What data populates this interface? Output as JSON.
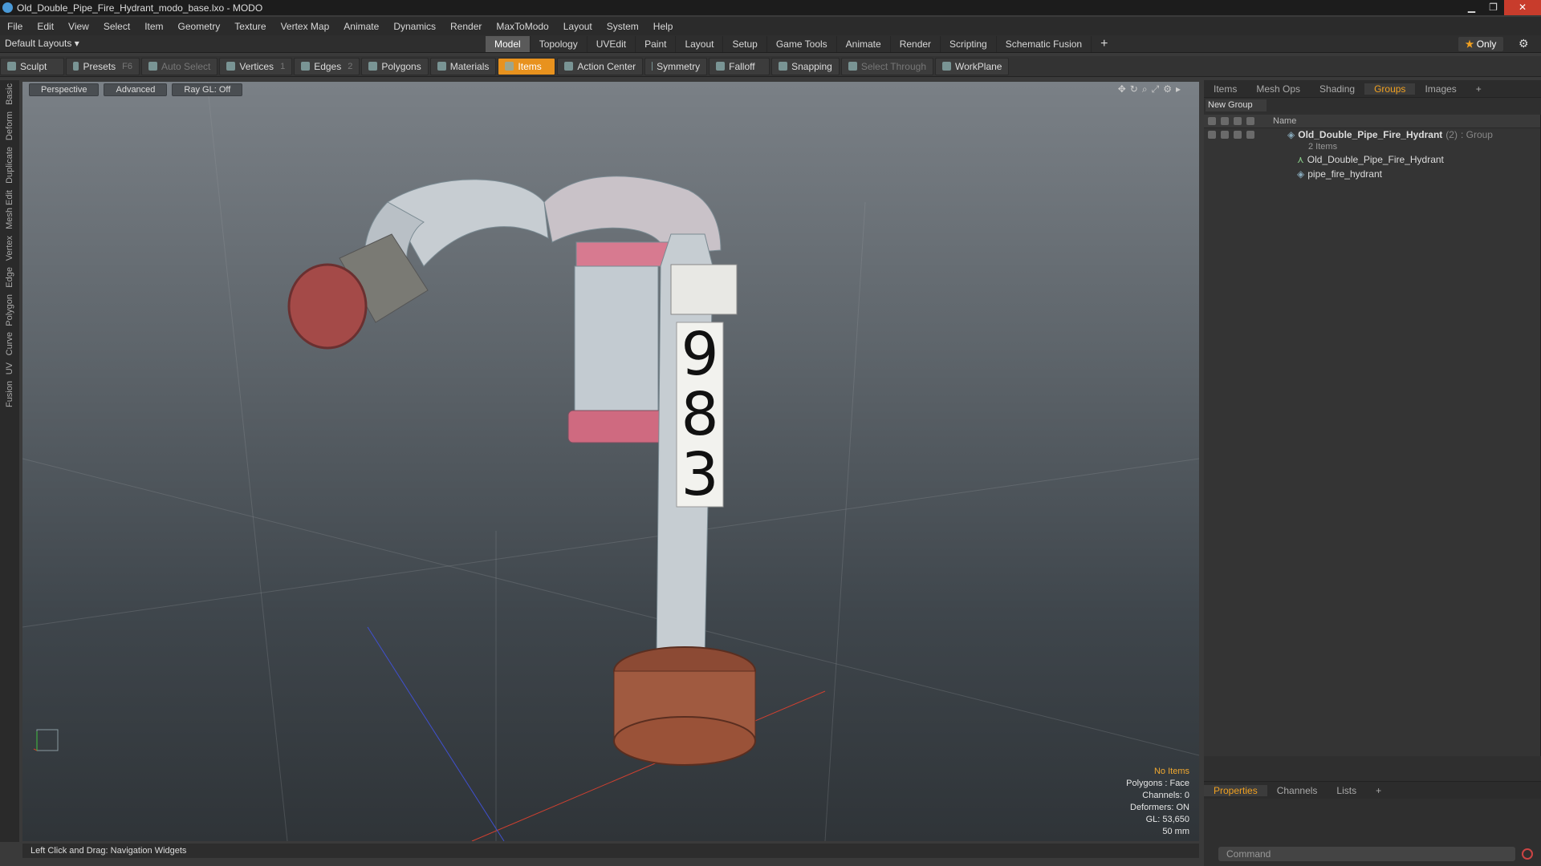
{
  "window": {
    "title": "Old_Double_Pipe_Fire_Hydrant_modo_base.lxo - MODO"
  },
  "menu": [
    "File",
    "Edit",
    "View",
    "Select",
    "Item",
    "Geometry",
    "Texture",
    "Vertex Map",
    "Animate",
    "Dynamics",
    "Render",
    "MaxToModo",
    "Layout",
    "System",
    "Help"
  ],
  "layout": {
    "default_layouts": "Default Layouts ▾",
    "tabs": [
      "Model",
      "Topology",
      "UVEdit",
      "Paint",
      "Layout",
      "Setup",
      "Game Tools",
      "Animate",
      "Render",
      "Scripting",
      "Schematic Fusion"
    ],
    "active_tab": "Model",
    "plus": "+",
    "only": "Only",
    "star": "★"
  },
  "toolbar": {
    "sculpt": "Sculpt",
    "presets": "Presets",
    "presets_key": "F6",
    "auto_select": "Auto Select",
    "vertices": "Vertices",
    "vertices_key": "1",
    "edges": "Edges",
    "edges_key": "2",
    "polygons": "Polygons",
    "materials": "Materials",
    "items": "Items",
    "action_center": "Action Center",
    "symmetry": "Symmetry",
    "falloff": "Falloff",
    "snapping": "Snapping",
    "select_through": "Select Through",
    "workplane": "WorkPlane"
  },
  "left_tabs": [
    "Basic",
    "Deform",
    "Duplicate",
    "Mesh Edit",
    "Vertex",
    "Edge",
    "Polygon",
    "Curve",
    "UV",
    "Fusion"
  ],
  "viewport": {
    "view": "Perspective",
    "advanced": "Advanced",
    "raygl": "Ray GL: Off",
    "sign_digits": [
      "9",
      "8",
      "3"
    ],
    "stats": {
      "no_items": "No Items",
      "polygons": "Polygons : Face",
      "channels": "Channels: 0",
      "deformers": "Deformers: ON",
      "gl": "GL: 53,650",
      "size": "50 mm"
    }
  },
  "status": {
    "hint": "Left Click and Drag:  Navigation Widgets"
  },
  "right_panel": {
    "tabs": [
      "Items",
      "Mesh Ops",
      "Shading",
      "Groups",
      "Images",
      "+"
    ],
    "active": "Groups",
    "new_group": "New Group",
    "name_header": "Name",
    "group": {
      "name": "Old_Double_Pipe_Fire_Hydrant",
      "count": "(2)",
      "type": ": Group",
      "sub": "2 Items"
    },
    "children": [
      "Old_Double_Pipe_Fire_Hydrant",
      "pipe_fire_hydrant"
    ],
    "prop_tabs": [
      "Properties",
      "Channels",
      "Lists",
      "+"
    ],
    "prop_active": "Properties",
    "command_placeholder": "Command"
  }
}
